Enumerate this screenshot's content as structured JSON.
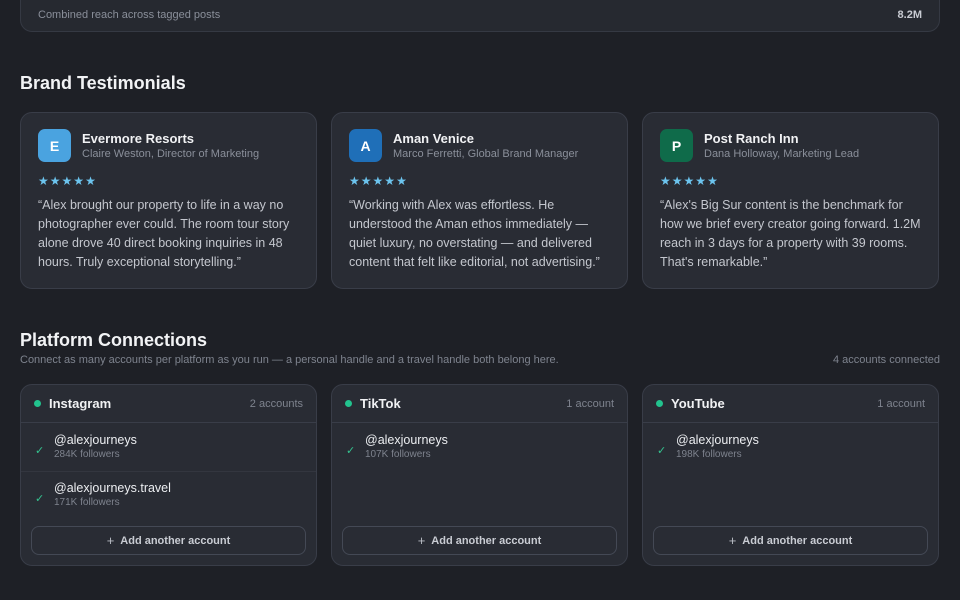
{
  "reach": {
    "label": "Combined reach across tagged posts",
    "value": "8.2M"
  },
  "testimonials": {
    "title": "Brand Testimonials",
    "items": [
      {
        "initial": "E",
        "avatar_color": "#4aa3e0",
        "brand": "Evermore Resorts",
        "person": "Claire Weston, Director of Marketing",
        "stars": 5,
        "quote": "“Alex brought our property to life in a way no photographer ever could. The room tour story alone drove 40 direct booking inquiries in 48 hours. Truly exceptional storytelling.”"
      },
      {
        "initial": "A",
        "avatar_color": "#1f6fb8",
        "brand": "Aman Venice",
        "person": "Marco Ferretti, Global Brand Manager",
        "stars": 5,
        "quote": "“Working with Alex was effortless. He understood the Aman ethos immediately — quiet luxury, no overstating — and delivered content that felt like editorial, not advertising.”"
      },
      {
        "initial": "P",
        "avatar_color": "#0f6b4a",
        "brand": "Post Ranch Inn",
        "person": "Dana Holloway, Marketing Lead",
        "stars": 5,
        "quote": "“Alex's Big Sur content is the benchmark for how we brief every creator going forward. 1.2M reach in 3 days for a property with 39 rooms. That's remarkable.”"
      }
    ]
  },
  "platforms": {
    "title": "Platform Connections",
    "subtitle": "Connect as many accounts per platform as you run — a personal handle and a travel handle both belong here.",
    "summary": "4 accounts connected",
    "add_label": "Add another account",
    "items": [
      {
        "name": "Instagram",
        "count": "2 accounts",
        "accounts": [
          {
            "handle": "@alexjourneys",
            "followers": "284K followers"
          },
          {
            "handle": "@alexjourneys.travel",
            "followers": "171K followers"
          }
        ]
      },
      {
        "name": "TikTok",
        "count": "1 account",
        "accounts": [
          {
            "handle": "@alexjourneys",
            "followers": "107K followers"
          }
        ]
      },
      {
        "name": "YouTube",
        "count": "1 account",
        "accounts": [
          {
            "handle": "@alexjourneys",
            "followers": "198K followers"
          }
        ]
      }
    ]
  },
  "colors": {
    "star": "#6cc4ee",
    "connected_dot": "#22c38e",
    "check": "#34c38f"
  }
}
